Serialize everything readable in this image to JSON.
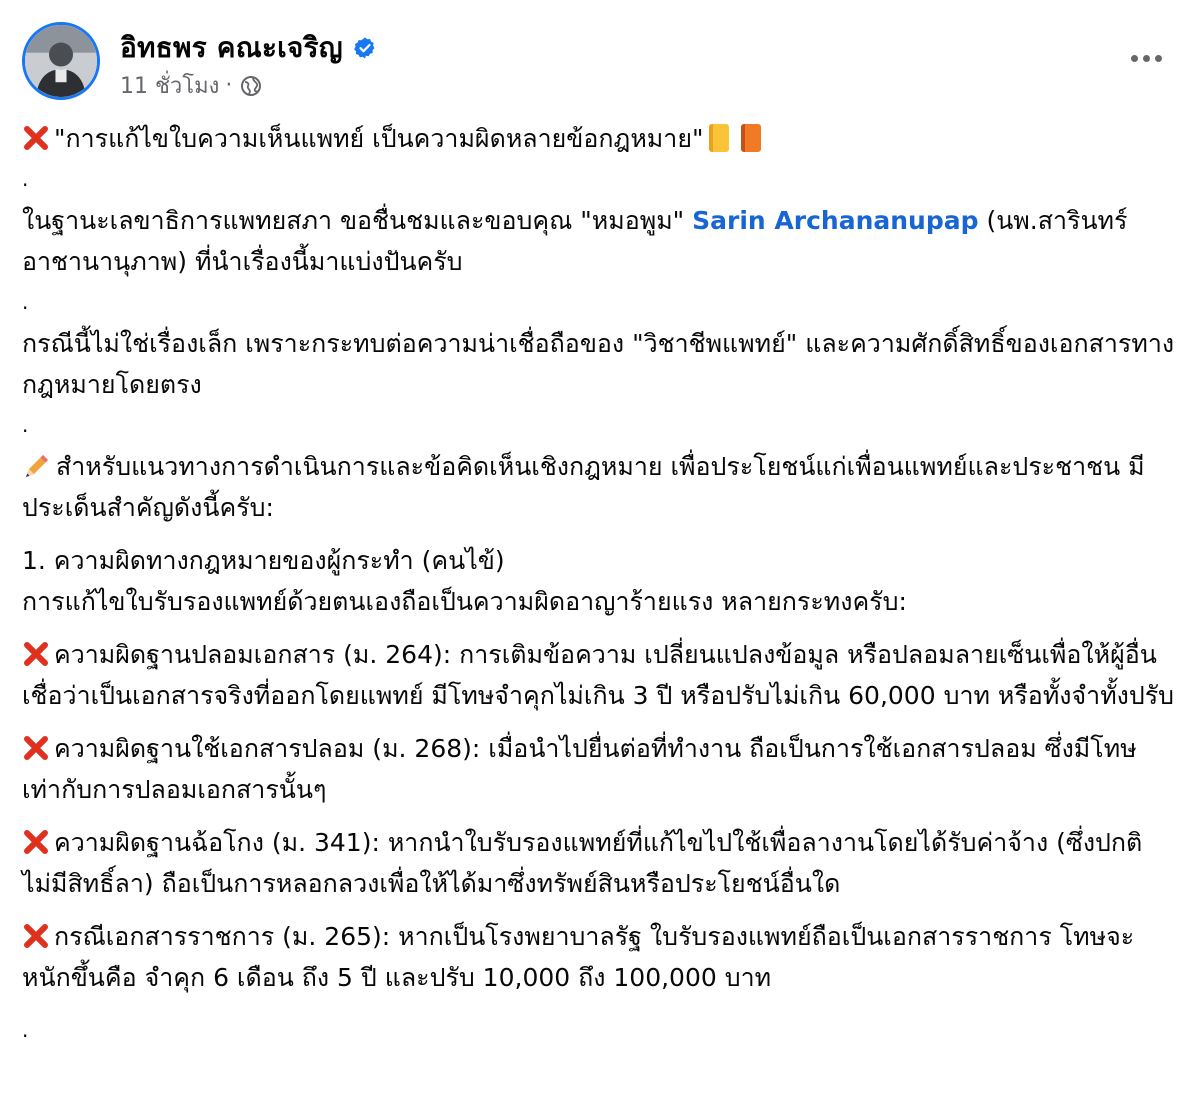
{
  "post": {
    "author": "อิทธพร คณะเจริญ",
    "time": "11 ชั่วโมง",
    "separator": "·",
    "icons": {
      "verified": "verified-badge-icon",
      "audience": "globe-icon",
      "more": "more-options-icon",
      "cross": "cross-mark-icon",
      "book_yellow": "yellow-book-icon",
      "book_orange": "orange-book-icon",
      "pencil": "pencil-icon"
    },
    "colors": {
      "link": "#1866d3",
      "verified": "#1877f2",
      "cross": "#e0311f",
      "meta": "#65676b"
    }
  },
  "body": {
    "headline": "\"การแก้ไขใบความเห็นแพทย์ เป็นความผิดหลายข้อกฎหมาย\"",
    "dot": ".",
    "p1_before": "ในฐานะเลขาธิการแพทยสภา ขอชื่นชมและขอบคุณ \"หมอพูม\" ",
    "p1_link": "Sarin Archananupap",
    "p1_after": "  (นพ.สารินทร์ อาชานานุภาพ)  ที่นำเรื่องนี้มาแบ่งปันครับ",
    "p2": " กรณีนี้ไม่ใช่เรื่องเล็ก เพราะกระทบต่อความน่าเชื่อถือของ \"วิชาชีพแพทย์\" และความศักดิ์สิทธิ์ของเอกสารทางกฎหมายโดยตรง",
    "p3": "สำหรับแนวทางการดำเนินการและข้อคิดเห็นเชิงกฎหมาย เพื่อประโยชน์แก่เพื่อนแพทย์และประชาชน มีประเด็นสำคัญดังนี้ครับ:",
    "s1_title": "1. ความผิดทางกฎหมายของผู้กระทำ (คนไข้)",
    "s1_intro": "การแก้ไขใบรับรองแพทย์ด้วยตนเองถือเป็นความผิดอาญาร้ายแรง หลายกระทงครับ:",
    "items": [
      "ความผิดฐานปลอมเอกสาร (ม. 264): การเติมข้อความ เปลี่ยนแปลงข้อมูล หรือปลอมลายเซ็นเพื่อให้ผู้อื่นเชื่อว่าเป็นเอกสารจริงที่ออกโดยแพทย์ มีโทษจำคุกไม่เกิน 3 ปี หรือปรับไม่เกิน 60,000 บาท หรือทั้งจำทั้งปรับ",
      "ความผิดฐานใช้เอกสารปลอม (ม. 268): เมื่อนำไปยื่นต่อที่ทำงาน ถือเป็นการใช้เอกสารปลอม ซึ่งมีโทษเท่ากับการปลอมเอกสารนั้นๆ",
      "ความผิดฐานฉ้อโกง (ม. 341): หากนำใบรับรองแพทย์ที่แก้ไขไปใช้เพื่อลางานโดยได้รับค่าจ้าง (ซึ่งปกติไม่มีสิทธิ์ลา) ถือเป็นการหลอกลวงเพื่อให้ได้มาซึ่งทรัพย์สินหรือประโยชน์อื่นใด",
      "กรณีเอกสารราชการ (ม. 265): หากเป็นโรงพยาบาลรัฐ ใบรับรองแพทย์ถือเป็นเอกสารราชการ โทษจะหนักขึ้นคือ จำคุก 6 เดือน ถึง 5 ปี และปรับ 10,000 ถึง 100,000 บาท"
    ]
  }
}
